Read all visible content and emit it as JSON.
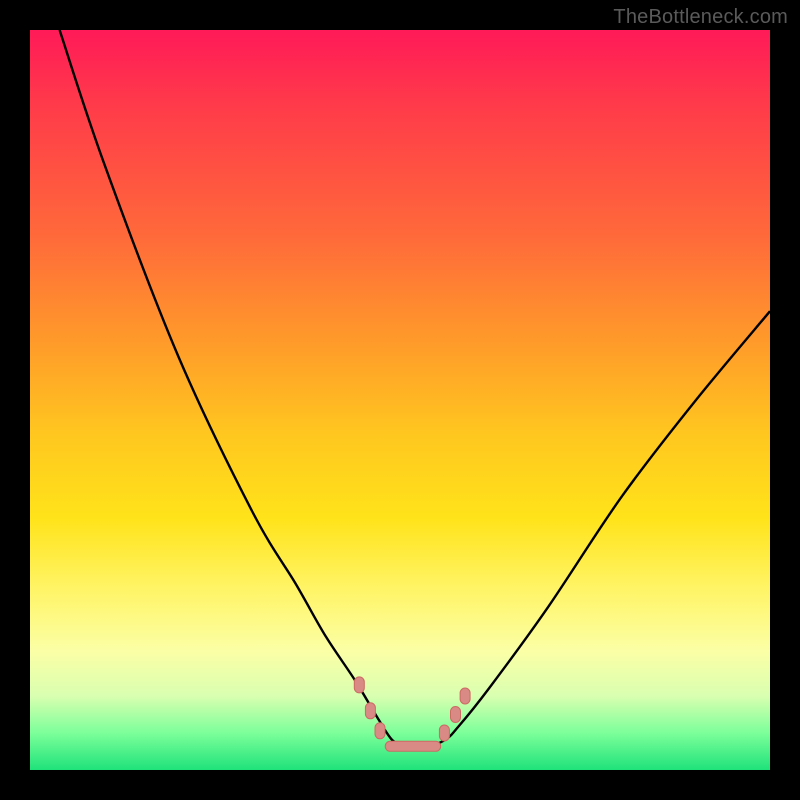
{
  "watermark": "TheBottleneck.com",
  "colors": {
    "frame": "#000000",
    "curve": "#000000",
    "marker_fill": "#d98a85",
    "marker_stroke": "#cc6b64"
  },
  "chart_data": {
    "type": "line",
    "title": "",
    "xlabel": "",
    "ylabel": "",
    "xlim": [
      0,
      100
    ],
    "ylim": [
      0,
      100
    ],
    "series": [
      {
        "name": "curve",
        "x": [
          4,
          10,
          20,
          30,
          36,
          40,
          44,
          47,
          49,
          51,
          53,
          56,
          58,
          62,
          70,
          80,
          90,
          100
        ],
        "y": [
          100,
          82,
          56,
          35,
          25,
          18,
          12,
          7,
          4,
          3,
          3,
          4,
          6,
          11,
          22,
          37,
          50,
          62
        ]
      }
    ],
    "markers": [
      {
        "x": 44.5,
        "y": 11.5
      },
      {
        "x": 46.0,
        "y": 8.0
      },
      {
        "x": 47.3,
        "y": 5.3
      },
      {
        "x": 56.0,
        "y": 5.0
      },
      {
        "x": 57.5,
        "y": 7.5
      },
      {
        "x": 58.8,
        "y": 10.0
      }
    ],
    "flat_segment": {
      "x_start": 48.0,
      "x_end": 55.5,
      "y": 3.2
    }
  }
}
